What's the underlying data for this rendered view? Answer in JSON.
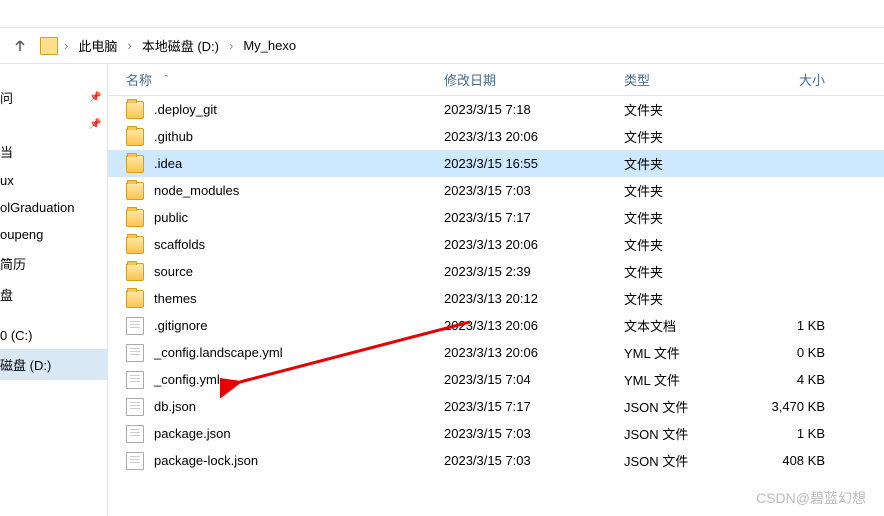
{
  "breadcrumb": {
    "items": [
      "此电脑",
      "本地磁盘 (D:)",
      "My_hexo"
    ]
  },
  "columns": {
    "name": "名称",
    "date": "修改日期",
    "type": "类型",
    "size": "大小"
  },
  "sidebar": {
    "items": [
      {
        "label": "问",
        "pin": true
      },
      {
        "label": "",
        "pin": true
      },
      {
        "label": "当",
        "pin": false
      },
      {
        "label": "ux",
        "pin": false
      },
      {
        "label": "olGraduation",
        "pin": false
      },
      {
        "label": "oupeng",
        "pin": false
      },
      {
        "label": "简历",
        "pin": false
      },
      {
        "label": "盘",
        "pin": false
      },
      {
        "label": "",
        "pin": false
      },
      {
        "label": "0 (C:)",
        "pin": false
      },
      {
        "label": "磁盘 (D:)",
        "pin": false,
        "selected": true
      }
    ]
  },
  "files": [
    {
      "name": ".deploy_git",
      "date": "2023/3/15 7:18",
      "type": "文件夹",
      "size": "",
      "icon": "folder"
    },
    {
      "name": ".github",
      "date": "2023/3/13 20:06",
      "type": "文件夹",
      "size": "",
      "icon": "folder"
    },
    {
      "name": ".idea",
      "date": "2023/3/15 16:55",
      "type": "文件夹",
      "size": "",
      "icon": "folder",
      "selected": true
    },
    {
      "name": "node_modules",
      "date": "2023/3/15 7:03",
      "type": "文件夹",
      "size": "",
      "icon": "folder"
    },
    {
      "name": "public",
      "date": "2023/3/15 7:17",
      "type": "文件夹",
      "size": "",
      "icon": "folder"
    },
    {
      "name": "scaffolds",
      "date": "2023/3/13 20:06",
      "type": "文件夹",
      "size": "",
      "icon": "folder"
    },
    {
      "name": "source",
      "date": "2023/3/15 2:39",
      "type": "文件夹",
      "size": "",
      "icon": "folder"
    },
    {
      "name": "themes",
      "date": "2023/3/13 20:12",
      "type": "文件夹",
      "size": "",
      "icon": "folder"
    },
    {
      "name": ".gitignore",
      "date": "2023/3/13 20:06",
      "type": "文本文档",
      "size": "1 KB",
      "icon": "file"
    },
    {
      "name": "_config.landscape.yml",
      "date": "2023/3/13 20:06",
      "type": "YML 文件",
      "size": "0 KB",
      "icon": "file"
    },
    {
      "name": "_config.yml",
      "date": "2023/3/15 7:04",
      "type": "YML 文件",
      "size": "4 KB",
      "icon": "file"
    },
    {
      "name": "db.json",
      "date": "2023/3/15 7:17",
      "type": "JSON 文件",
      "size": "3,470 KB",
      "icon": "file"
    },
    {
      "name": "package.json",
      "date": "2023/3/15 7:03",
      "type": "JSON 文件",
      "size": "1 KB",
      "icon": "file"
    },
    {
      "name": "package-lock.json",
      "date": "2023/3/15 7:03",
      "type": "JSON 文件",
      "size": "408 KB",
      "icon": "file"
    }
  ],
  "watermark": "CSDN@碧蓝幻想"
}
